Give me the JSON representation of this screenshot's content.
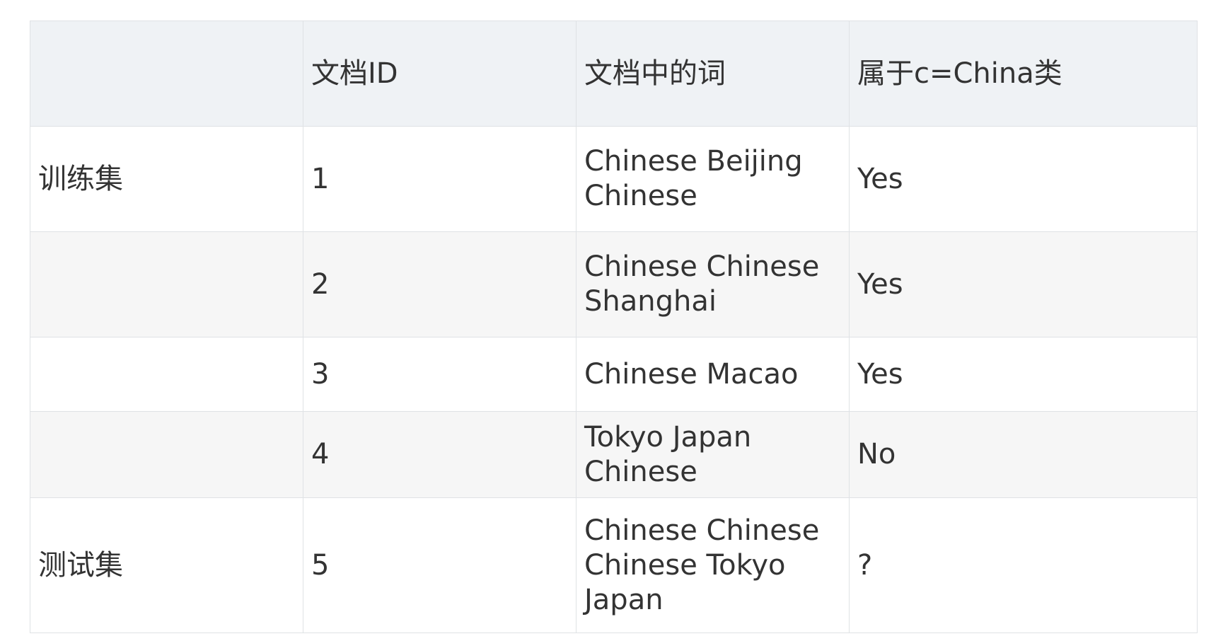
{
  "table": {
    "headers": [
      "",
      "文档ID",
      "文档中的词",
      "属于c=China类"
    ],
    "rows": [
      {
        "set": "训练集",
        "id": "1",
        "words": "Chinese Beijing Chinese",
        "label": "Yes"
      },
      {
        "set": "",
        "id": "2",
        "words": "Chinese Chinese Shanghai",
        "label": "Yes"
      },
      {
        "set": "",
        "id": "3",
        "words": "Chinese Macao",
        "label": "Yes"
      },
      {
        "set": "",
        "id": "4",
        "words": "Tokyo Japan Chinese",
        "label": "No"
      },
      {
        "set": "测试集",
        "id": "5",
        "words": "Chinese Chinese Chinese Tokyo Japan",
        "label": "?"
      }
    ]
  }
}
